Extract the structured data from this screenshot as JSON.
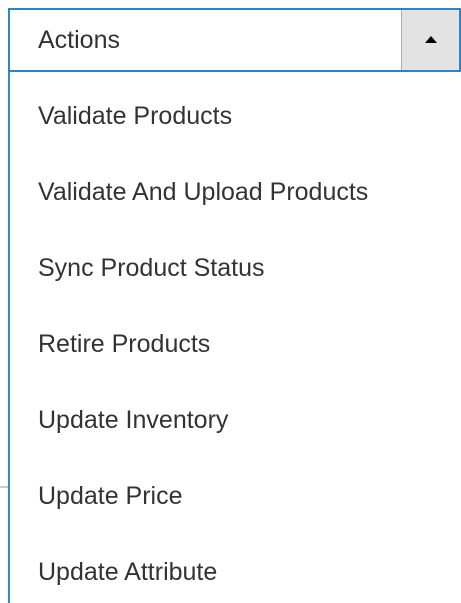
{
  "actions_dropdown": {
    "toggle_label": "Actions",
    "expanded": true,
    "toggle_icon": "triangle-up-icon",
    "accent_color": "#2f84c7",
    "items": [
      {
        "label": "Validate Products"
      },
      {
        "label": "Validate And Upload Products"
      },
      {
        "label": "Sync Product Status"
      },
      {
        "label": "Retire Products"
      },
      {
        "label": "Update Inventory"
      },
      {
        "label": "Update Price"
      },
      {
        "label": "Update Attribute"
      }
    ]
  }
}
